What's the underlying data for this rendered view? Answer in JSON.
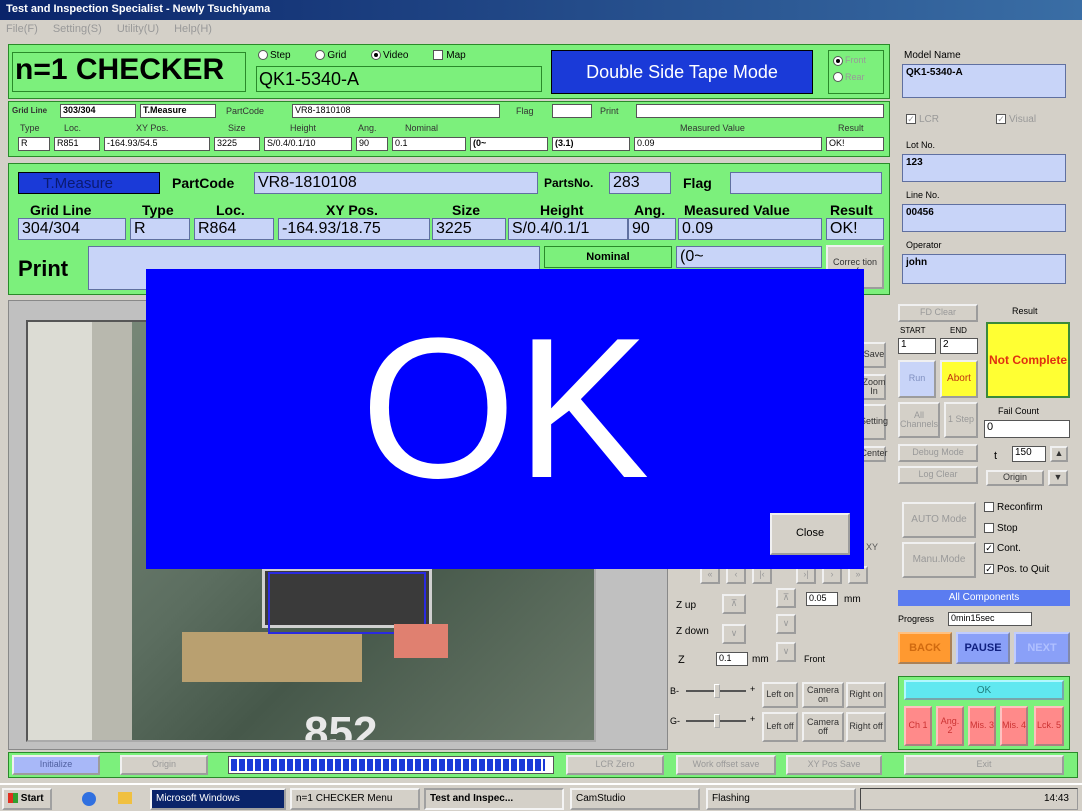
{
  "window": {
    "title": "Test and Inspection Specialist - Newly Tsuchiyama"
  },
  "menu": [
    "File(F)",
    "Setting(S)",
    "Utility(U)",
    "Help(H)"
  ],
  "header": {
    "app_name": "n=1 CHECKER",
    "model_value": "QK1-5340-A",
    "mode_button": "Double Side Tape Mode",
    "view_options": [
      {
        "label": "Step",
        "on": false
      },
      {
        "label": "Grid",
        "on": false
      },
      {
        "label": "Video",
        "on": true
      }
    ],
    "map_label": "Map",
    "face_options": [
      "Front",
      "Rear"
    ]
  },
  "summary_row": {
    "grid_line_label": "Grid Line",
    "grid_line_value": "303/304",
    "t_measure": "T.Measure",
    "partcode_label": "PartCode",
    "partcode_value": "VR8-1810108",
    "flag_label": "Flag",
    "print_label": "Print",
    "headers": [
      "Type",
      "Loc.",
      "XY Pos.",
      "Size",
      "Height",
      "Ang.",
      "Nominal",
      "Measured Value",
      "Result"
    ],
    "values": [
      "R",
      "R851",
      "-164.93/54.5",
      "3225",
      "S/0.4/0.1/10",
      "90",
      "0.1",
      "(0~",
      "(3.1)",
      "0.09",
      "OK!"
    ]
  },
  "detail": {
    "measure_label": "T.Measure",
    "partcode_label": "PartCode",
    "partcode_value": "VR8-1810108",
    "partsno_label": "PartsNo.",
    "partsno_value": "283",
    "flag_label": "Flag",
    "headers": [
      "Grid Line",
      "Type",
      "Loc.",
      "XY Pos.",
      "Size",
      "Height",
      "Ang.",
      "Measured Value",
      "Result"
    ],
    "values": [
      "304/304",
      "R",
      "R864",
      "-164.93/18.75",
      "3225",
      "S/0.4/0.1/1",
      "90",
      "0.09",
      "OK!"
    ],
    "print_label": "Print",
    "nominal_label": "Nominal",
    "nominal_value": "(0~",
    "correction_label": "Correc tion of"
  },
  "camera": {
    "pcb_label": "852",
    "xy_label": "XY"
  },
  "controls": {
    "z_up": "Z up",
    "z_down": "Z down",
    "z_label": "Z",
    "z_step_value": "0.05",
    "z_value": "0.1",
    "unit_mm": "mm",
    "front_label": "Front",
    "light_rows": [
      {
        "minus": "B-",
        "plus": "+",
        "buttons": [
          "Left on",
          "Camera on",
          "Right on"
        ]
      },
      {
        "minus": "G-",
        "plus": "+",
        "buttons": [
          "Left off",
          "Camera off",
          "Right off"
        ]
      }
    ],
    "partial_buttons": [
      "Save",
      "Zoom In",
      "Setting",
      "Center"
    ]
  },
  "sidebar": {
    "model_label": "Model Name",
    "model_value": "QK1-5340-A",
    "lcr_label": "LCR",
    "visual_label": "Visual",
    "lot_label": "Lot No.",
    "lot_value": "123",
    "line_label": "Line No.",
    "line_value": "00456",
    "operator_label": "Operator",
    "operator_value": "john",
    "fd_clear": "FD Clear",
    "start_label": "START",
    "end_label": "END",
    "start_value": "1",
    "end_value": "2",
    "run": "Run",
    "abort": "Abort",
    "all_channels": "All Channels",
    "one_step": "1 Step",
    "debug_mode": "Debug Mode",
    "log_clear": "Log Clear",
    "result_label": "Result",
    "result_value": "Not Complete",
    "fail_count_label": "Fail Count",
    "fail_count_value": "0",
    "t_label": "t",
    "t_value": "150",
    "origin_small": "Origin",
    "auto_mode": "AUTO Mode",
    "manu_mode": "Manu.Mode",
    "options": [
      {
        "label": "Reconfirm",
        "on": false
      },
      {
        "label": "Stop",
        "on": false
      },
      {
        "label": "Cont.",
        "on": true
      },
      {
        "label": "Pos. to Quit",
        "on": true
      }
    ],
    "all_components": "All Components",
    "progress_label": "Progress",
    "progress_value": "0min15sec",
    "back": "BACK",
    "pause": "PAUSE",
    "next": "NEXT",
    "ok": "OK",
    "ng_buttons": [
      "Ch 1",
      "Ang. 2",
      "Mis. 3",
      "Mis. 4",
      "Lck. 5"
    ],
    "exit": "Exit"
  },
  "bottom": {
    "initialize": "Initialize",
    "origin": "Origin",
    "lcr_zero": "LCR Zero",
    "work_offset": "Work offset save",
    "xy_pos_save": "XY Pos Save",
    "progress_fraction": 0.98
  },
  "overlay": {
    "message": "OK",
    "close": "Close"
  },
  "taskbar": {
    "start": "Start",
    "items": [
      "Microsoft Windows",
      "n=1 CHECKER Menu",
      "Test and Inspec...",
      "CamStudio",
      "Flashing"
    ],
    "clock": "14:43"
  },
  "colors": {
    "overlay_bg": "#0000ff",
    "green": "#7cf07c",
    "result_bg": "#ffff33",
    "result_text": "#e03010",
    "field": "#c8d4f8",
    "mode_btn": "#1a3ad8"
  }
}
